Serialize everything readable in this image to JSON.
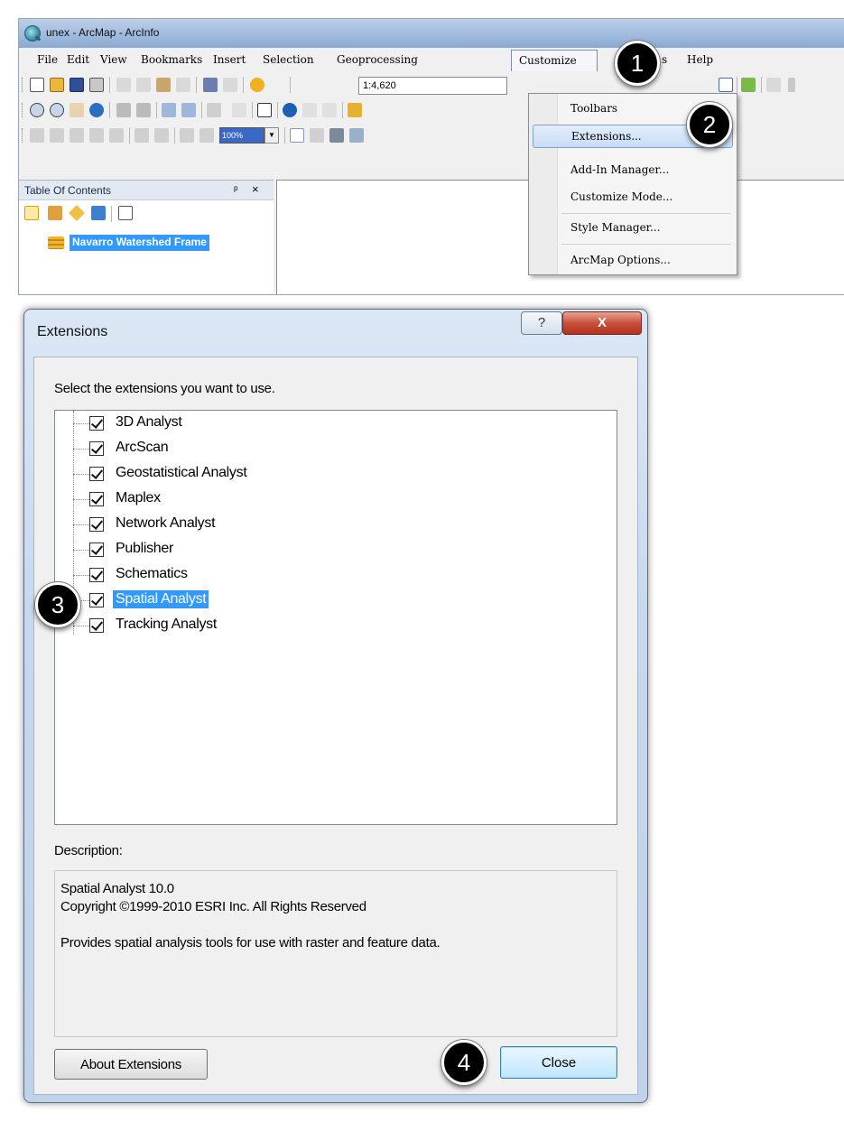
{
  "app": {
    "title": "unex - ArcMap - ArcInfo"
  },
  "menubar": {
    "items": [
      "File",
      "Edit",
      "View",
      "Bookmarks",
      "Insert",
      "Selection",
      "Geoprocessing",
      "Customize",
      "s",
      "Help"
    ]
  },
  "toolbar": {
    "scale": "1:4,620",
    "zoom_value": "100%"
  },
  "toc": {
    "title": "Table Of Contents",
    "pin": "ᵖ",
    "close": "×",
    "layer": "Navarro Watershed Frame"
  },
  "customize_menu": {
    "items": [
      "Toolbars",
      "Extensions...",
      "Add-In Manager...",
      "Customize Mode...",
      "Style Manager...",
      "ArcMap Options..."
    ],
    "highlighted": "Extensions..."
  },
  "dialog": {
    "title": "Extensions",
    "help": "?",
    "close_x": "X",
    "instruction": "Select the extensions you want to use.",
    "extensions": [
      {
        "name": "3D Analyst",
        "checked": true
      },
      {
        "name": "ArcScan",
        "checked": true
      },
      {
        "name": "Geostatistical Analyst",
        "checked": true
      },
      {
        "name": "Maplex",
        "checked": true
      },
      {
        "name": "Network Analyst",
        "checked": true
      },
      {
        "name": "Publisher",
        "checked": true
      },
      {
        "name": "Schematics",
        "checked": true
      },
      {
        "name": "Spatial Analyst",
        "checked": true
      },
      {
        "name": "Tracking Analyst",
        "checked": true
      }
    ],
    "selected_extension": "Spatial Analyst",
    "description_label": "Description:",
    "description": {
      "line1": "Spatial Analyst 10.0",
      "line2": "Copyright ©1999-2010 ESRI Inc. All Rights Reserved",
      "line3": "Provides spatial analysis tools for use with raster and feature data."
    },
    "about_button": "About Extensions",
    "close_button": "Close"
  },
  "callouts": [
    "1",
    "2",
    "3",
    "4"
  ]
}
